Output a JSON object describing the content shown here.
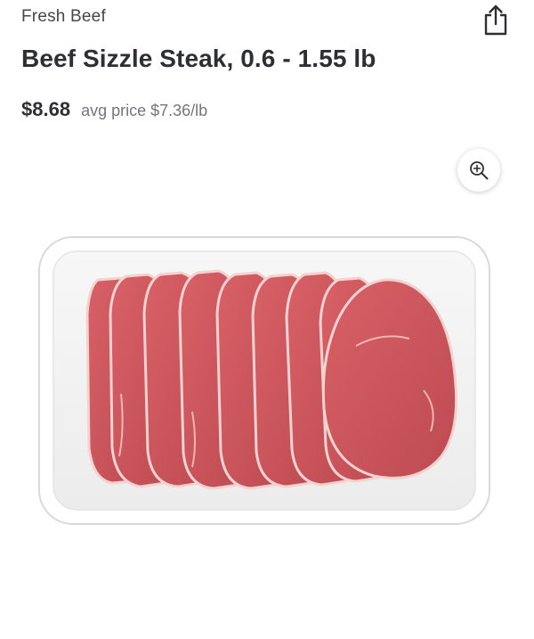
{
  "product": {
    "category": "Fresh Beef",
    "title": "Beef Sizzle Steak, 0.6 - 1.55 lb",
    "price": "$8.68",
    "unit_price": "avg price $7.36/lb"
  },
  "icons": {
    "share": "share-icon",
    "zoom": "zoom-in-icon"
  },
  "colors": {
    "text_primary": "#2e2f32",
    "text_secondary": "#74767c",
    "meat": "#c9545a",
    "tray": "#ffffff"
  }
}
